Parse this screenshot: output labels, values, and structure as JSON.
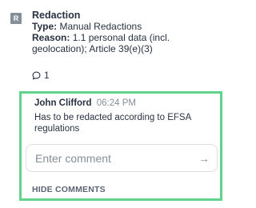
{
  "annotation": {
    "badge": "R",
    "title": "Redaction",
    "type_label": "Type:",
    "type_value": "Manual Redactions",
    "reason_label": "Reason:",
    "reason_value_line1": "1.1 personal data (incl.",
    "reason_value_line2": "geolocation); Article 39(e)(3)",
    "comment_count": "1"
  },
  "comments": {
    "items": [
      {
        "author": "John Clifford",
        "time": "06:24 PM",
        "text_line1": "Has to be redacted according to EFSA",
        "text_line2": "regulations"
      }
    ],
    "input_placeholder": "Enter comment",
    "send_icon": "arrow-right-icon",
    "hide_label": "HIDE COMMENTS"
  },
  "colors": {
    "highlight_border": "#5fd48a",
    "badge_bg": "#868e98",
    "text": "#283241",
    "muted": "#868e98"
  }
}
